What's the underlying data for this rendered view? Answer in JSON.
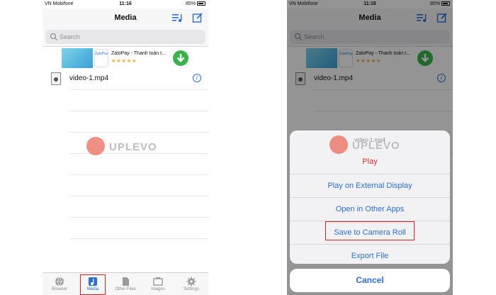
{
  "status": {
    "carrier": "VN Mobifone",
    "time": "11:16",
    "battery": "85%"
  },
  "nav": {
    "title": "Media"
  },
  "search": {
    "placeholder": "Search"
  },
  "ad": {
    "title": "ZaloPay - Thanh toán t...",
    "stars": "★★★★★",
    "logo": "ZaloPay"
  },
  "file": {
    "name": "video-1.mp4"
  },
  "watermark": "UPLEVO",
  "tabs": [
    {
      "label": "Browser",
      "icon": "globe-icon"
    },
    {
      "label": "Media",
      "icon": "music-note-icon"
    },
    {
      "label": "Other Files",
      "icon": "file-icon"
    },
    {
      "label": "Images",
      "icon": "image-icon"
    },
    {
      "label": "Settings",
      "icon": "gear-icon"
    }
  ],
  "sheet": {
    "title": "video-1.mp4",
    "items": [
      {
        "label": "Play"
      },
      {
        "label": "Play on External Display"
      },
      {
        "label": "Open in Other Apps"
      },
      {
        "label": "Save to Camera Roll"
      },
      {
        "label": "Export File"
      }
    ],
    "cancel": "Cancel"
  },
  "colors": {
    "accent": "#2b6fd6",
    "destructive": "#e0302a",
    "highlight": "#e02020"
  }
}
